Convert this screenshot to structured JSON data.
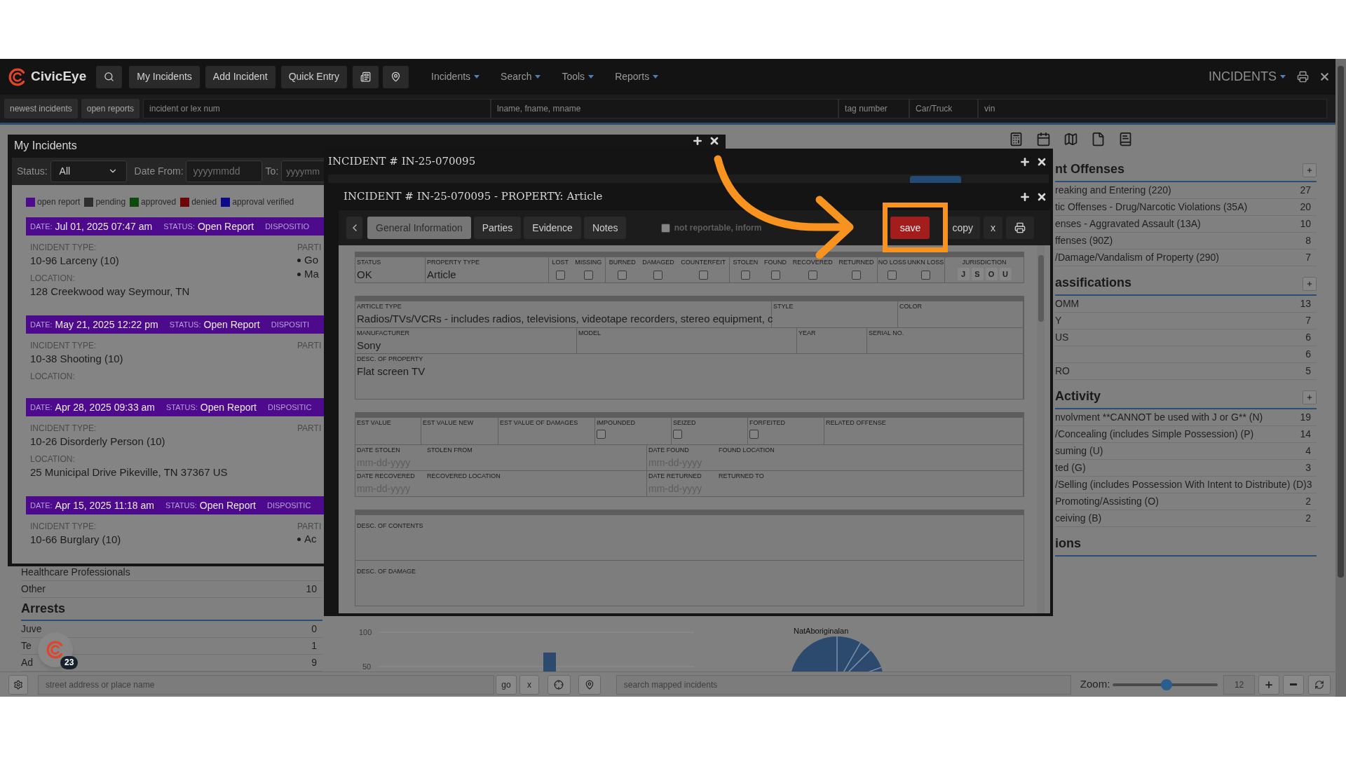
{
  "navbar": {
    "logo": "CivicEye",
    "buttons": [
      "My Incidents",
      "Add Incident",
      "Quick Entry"
    ],
    "menus": [
      "Incidents",
      "Search",
      "Tools",
      "Reports"
    ],
    "module": "INCIDENTS"
  },
  "quick_search": {
    "buttons": [
      "newest incidents",
      "open reports"
    ],
    "fields": [
      {
        "placeholder": "incident or lex num"
      },
      {
        "placeholder": "lname, fname, mname"
      },
      {
        "placeholder": "tag number"
      },
      {
        "placeholder": "Car/Truck"
      },
      {
        "placeholder": "vin"
      }
    ]
  },
  "dashboard": {
    "left_rows": [
      {
        "label": "Healthcare Professionals"
      },
      {
        "label": "Other",
        "count": "10"
      }
    ],
    "arrests": {
      "title": "Arrests",
      "rows": [
        {
          "label": "Juve",
          "count": "0"
        },
        {
          "label": "Te",
          "count": "1"
        },
        {
          "label": "Ad",
          "count": "9"
        }
      ]
    },
    "chart_fragment": {
      "tick_labels": [
        "100",
        "50"
      ],
      "pie_label": "NatAboriginalan"
    },
    "sections": [
      {
        "title": "nt Offenses",
        "rows": [
          {
            "label": "reaking and Entering (220)",
            "count": "27"
          },
          {
            "label": "tic Offenses - Drug/Narcotic Violations (35A)",
            "count": "20"
          },
          {
            "label": "enses - Aggravated Assault (13A)",
            "count": "10"
          },
          {
            "label": "ffenses (90Z)",
            "count": "8"
          },
          {
            "label": "/Damage/Vandalism of Property (290)",
            "count": "7"
          }
        ]
      },
      {
        "title": "assifications",
        "rows": [
          {
            "label": "OMM",
            "count": "13"
          },
          {
            "label": "Y",
            "count": "7"
          },
          {
            "label": "US",
            "count": "6"
          },
          {
            "count": "6"
          },
          {
            "label": "RO",
            "count": "5"
          }
        ]
      },
      {
        "title": "Activity",
        "rows": [
          {
            "label": "nvolvment **CANNOT be used with J or G** (N)",
            "count": "19"
          },
          {
            "label": "/Concealing (includes Simple Possession) (P)",
            "count": "14"
          },
          {
            "label": "suming (U)",
            "count": "4"
          },
          {
            "label": "ted (G)",
            "count": "3"
          },
          {
            "label": "/Selling (includes Possession With Intent to Distribute) (D)",
            "count": "3"
          },
          {
            "label": "Promoting/Assisting (O)",
            "count": "2"
          },
          {
            "label": "ceiving (B)",
            "count": "2"
          }
        ]
      },
      {
        "title": "ions"
      }
    ]
  },
  "notification": {
    "count": "23"
  },
  "my_incidents": {
    "title": "My Incidents",
    "filters": {
      "status_label": "Status:",
      "status_value": "All",
      "from_label": "Date From:",
      "from_placeholder": "yyyymmdd",
      "to_label": "To:",
      "to_placeholder": "yyyymm"
    },
    "legend": [
      {
        "label": "open report",
        "color": "#4d0a8c"
      },
      {
        "label": "pending",
        "color": "#2e2e2e"
      },
      {
        "label": "approved",
        "color": "#0b4a0b"
      },
      {
        "label": "denied",
        "color": "#6e0606"
      },
      {
        "label": "approval verified",
        "color": "#0a0a8a"
      }
    ],
    "incidents": [
      {
        "color": "#4d0a8c",
        "date_label": "DATE:",
        "date": "Jul 01, 2025 07:47 am",
        "status_label": "STATUS:",
        "status": "Open Report",
        "disposition_label": "DISPOSITIO",
        "type_label": "INCIDENT TYPE:",
        "type": "10-96 Larceny (10)",
        "parties_label": "PARTI",
        "parties": [
          "Go",
          "Ma"
        ],
        "location_label": "LOCATION:",
        "location": "128 Creekwood way Seymour, TN"
      },
      {
        "color": "#4d0a8c",
        "date_label": "DATE:",
        "date": "May 21, 2025 12:22 pm",
        "status_label": "STATUS:",
        "status": "Open Report",
        "disposition_label": "DISPOSITI",
        "type_label": "INCIDENT TYPE:",
        "type": "10-38 Shooting (10)",
        "parties_label": "PARTI",
        "location_label": "LOCATION:"
      },
      {
        "color": "#4d0a8c",
        "date_label": "DATE:",
        "date": "Apr 28, 2025 09:33 am",
        "status_label": "STATUS:",
        "status": "Open Report",
        "disposition_label": "DISPOSITIC",
        "type_label": "INCIDENT TYPE:",
        "type": "10-26 Disorderly Person (10)",
        "parties_label": "PARTI",
        "location_label": "LOCATION:",
        "location": "25 Municipal Drive Pikeville, TN 37367 US"
      },
      {
        "color": "#4d0a8c",
        "date_label": "DATE:",
        "date": "Apr 15, 2025 11:18 am",
        "status_label": "STATUS:",
        "status": "Open Report",
        "disposition_label": "DISPOSITIC",
        "type_label": "INCIDENT TYPE:",
        "type": "10-66 Burglary (10)",
        "parties_label": "PARTI",
        "parties": [
          "Ac"
        ]
      }
    ]
  },
  "incident_window": {
    "title": "INCIDENT # IN-25-070095"
  },
  "property_window": {
    "title": "INCIDENT # IN-25-070095 - PROPERTY: Article",
    "tabs": [
      {
        "label": "General Information",
        "selected": true
      },
      {
        "label": "Parties",
        "selected": false
      },
      {
        "label": "Evidence",
        "selected": false
      },
      {
        "label": "Notes",
        "selected": false
      }
    ],
    "not_reportable": {
      "label": "not reportable, inform",
      "checked": false
    },
    "actions": [
      {
        "label": "save",
        "kind": "primary"
      },
      {
        "label": "copy",
        "kind": "default"
      },
      {
        "label": "x",
        "kind": "default"
      }
    ],
    "form": {
      "status": {
        "label": "STATUS",
        "value": "OK"
      },
      "property_type": {
        "label": "PROPERTY TYPE",
        "value": "Article"
      },
      "flag_groups": [
        [
          {
            "label": "LOST",
            "checked": false
          },
          {
            "label": "MISSING",
            "checked": false
          }
        ],
        [
          {
            "label": "BURNED",
            "checked": false
          },
          {
            "label": "DAMAGED",
            "checked": false
          },
          {
            "label": "COUNTERFEIT",
            "checked": false
          }
        ],
        [
          {
            "label": "STOLEN",
            "checked": false
          },
          {
            "label": "FOUND",
            "checked": false
          },
          {
            "label": "RECOVERED",
            "checked": false
          },
          {
            "label": "RETURNED",
            "checked": false
          }
        ],
        [
          {
            "label": "NO LOSS",
            "checked": false
          },
          {
            "label": "UNKN LOSS",
            "checked": false
          }
        ]
      ],
      "jurisdiction": {
        "label": "JURISDICTION",
        "options": [
          {
            "label": "J",
            "selected": false
          },
          {
            "label": "S",
            "selected": false
          },
          {
            "label": "O",
            "selected": false
          },
          {
            "label": "U",
            "selected": false
          }
        ]
      },
      "article_rows": [
        [
          {
            "label": "ARTICLE TYPE",
            "value": "Radios/TVs/VCRs - includes radios, televisions, videotape recorders, stereo equipment, c"
          },
          {
            "label": "STYLE"
          },
          {
            "label": "COLOR"
          }
        ],
        [
          {
            "label": "MANUFACTURER",
            "value": "Sony"
          },
          {
            "label": "MODEL"
          },
          {
            "label": "YEAR"
          },
          {
            "label": "SERIAL NO."
          }
        ],
        [
          {
            "label": "DESC. OF PROPERTY",
            "value": "Flat screen TV"
          }
        ]
      ],
      "value_row": [
        {
          "label": "EST VALUE",
          "kind": "text"
        },
        {
          "label": "EST VALUE NEW",
          "kind": "text"
        },
        {
          "label": "EST VALUE OF DAMAGES",
          "kind": "text"
        },
        {
          "label": "IMPOUNDED",
          "kind": "checkbox",
          "checked": false
        },
        {
          "label": "SEIZED",
          "kind": "checkbox",
          "checked": false
        },
        {
          "label": "FORFEITED",
          "kind": "checkbox",
          "checked": false
        },
        {
          "label": "RELATED OFFENSE",
          "kind": "text"
        }
      ],
      "date_rows": [
        [
          {
            "date_label": "DATE STOLEN",
            "placeholder": "mm-dd-yyyy",
            "place_label": "STOLEN FROM"
          },
          {
            "date_label": "DATE FOUND",
            "placeholder": "mm-dd-yyyy",
            "place_label": "FOUND LOCATION"
          }
        ],
        [
          {
            "date_label": "DATE RECOVERED",
            "placeholder": "mm-dd-yyyy",
            "place_label": "RECOVERED LOCATION"
          },
          {
            "date_label": "DATE RETURNED",
            "placeholder": "mm-dd-yyyy",
            "place_label": "RETURNED TO"
          }
        ]
      ],
      "text_areas": [
        {
          "label": "DESC. OF CONTENTS"
        },
        {
          "label": "DESC. OF DAMAGE"
        }
      ]
    }
  },
  "map_bar": {
    "address_placeholder": "street address or place name",
    "go": "go",
    "clear": "x",
    "search_placeholder": "search mapped incidents",
    "zoom_label": "Zoom:",
    "zoom": {
      "level": 0.51
    },
    "zoom_value": "12"
  }
}
